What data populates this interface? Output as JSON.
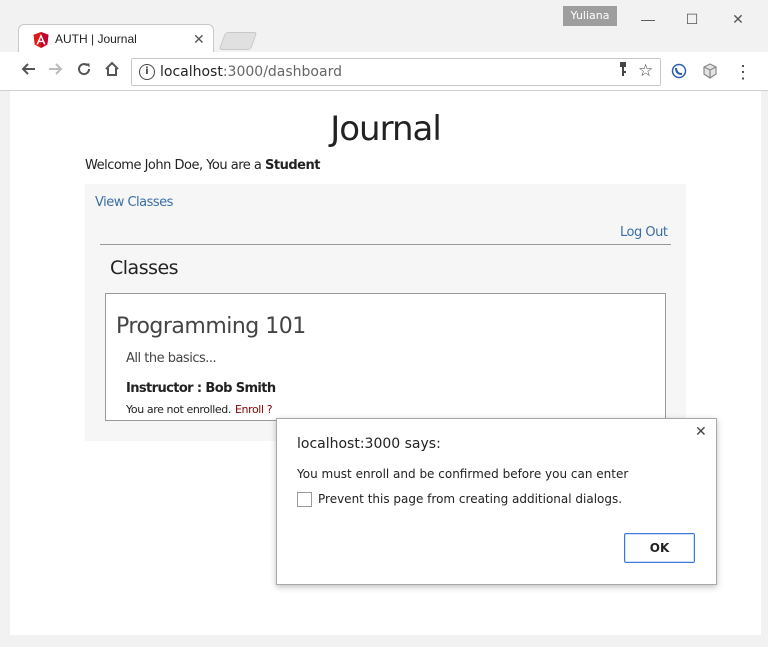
{
  "browser": {
    "profile_name": "Yuliana",
    "tab_title": "AUTH | Journal",
    "tab_close": "✕",
    "url_host": "localhost",
    "url_rest": ":3000/dashboard",
    "icons": {
      "tab_favicon": "angular-shield-icon",
      "back": "arrow-left-icon",
      "forward": "arrow-right-icon",
      "reload": "reload-icon",
      "home": "home-icon",
      "info": "info-icon",
      "key": "key-icon",
      "star": "star-icon",
      "menu": "more-vert-icon"
    },
    "window_controls": {
      "minimize": "—",
      "maximize": "☐",
      "close": "✕"
    }
  },
  "page": {
    "title": "Journal",
    "welcome_prefix": "Welcome John Doe, You are a ",
    "welcome_role": "Student",
    "nav": {
      "view_classes": "View Classes",
      "log_out": "Log Out"
    },
    "section_title": "Classes",
    "classes": [
      {
        "name": "Programming 101",
        "description": "All the basics...",
        "instructor": "Instructor : Bob Smith",
        "enroll_status": "You are not enrolled.",
        "enroll_link": "Enroll ?"
      }
    ]
  },
  "dialog": {
    "title": "localhost:3000 says:",
    "message": "You must enroll and be confirmed before you can enter",
    "checkbox_label": "Prevent this page from creating additional dialogs.",
    "checkbox_checked": false,
    "ok_label": "OK",
    "close": "✕"
  },
  "colors": {
    "link": "#3a6ea5",
    "enroll_link": "#8b0000",
    "ok_border": "#3c7ad6",
    "angular_red": "#dd1b16"
  }
}
